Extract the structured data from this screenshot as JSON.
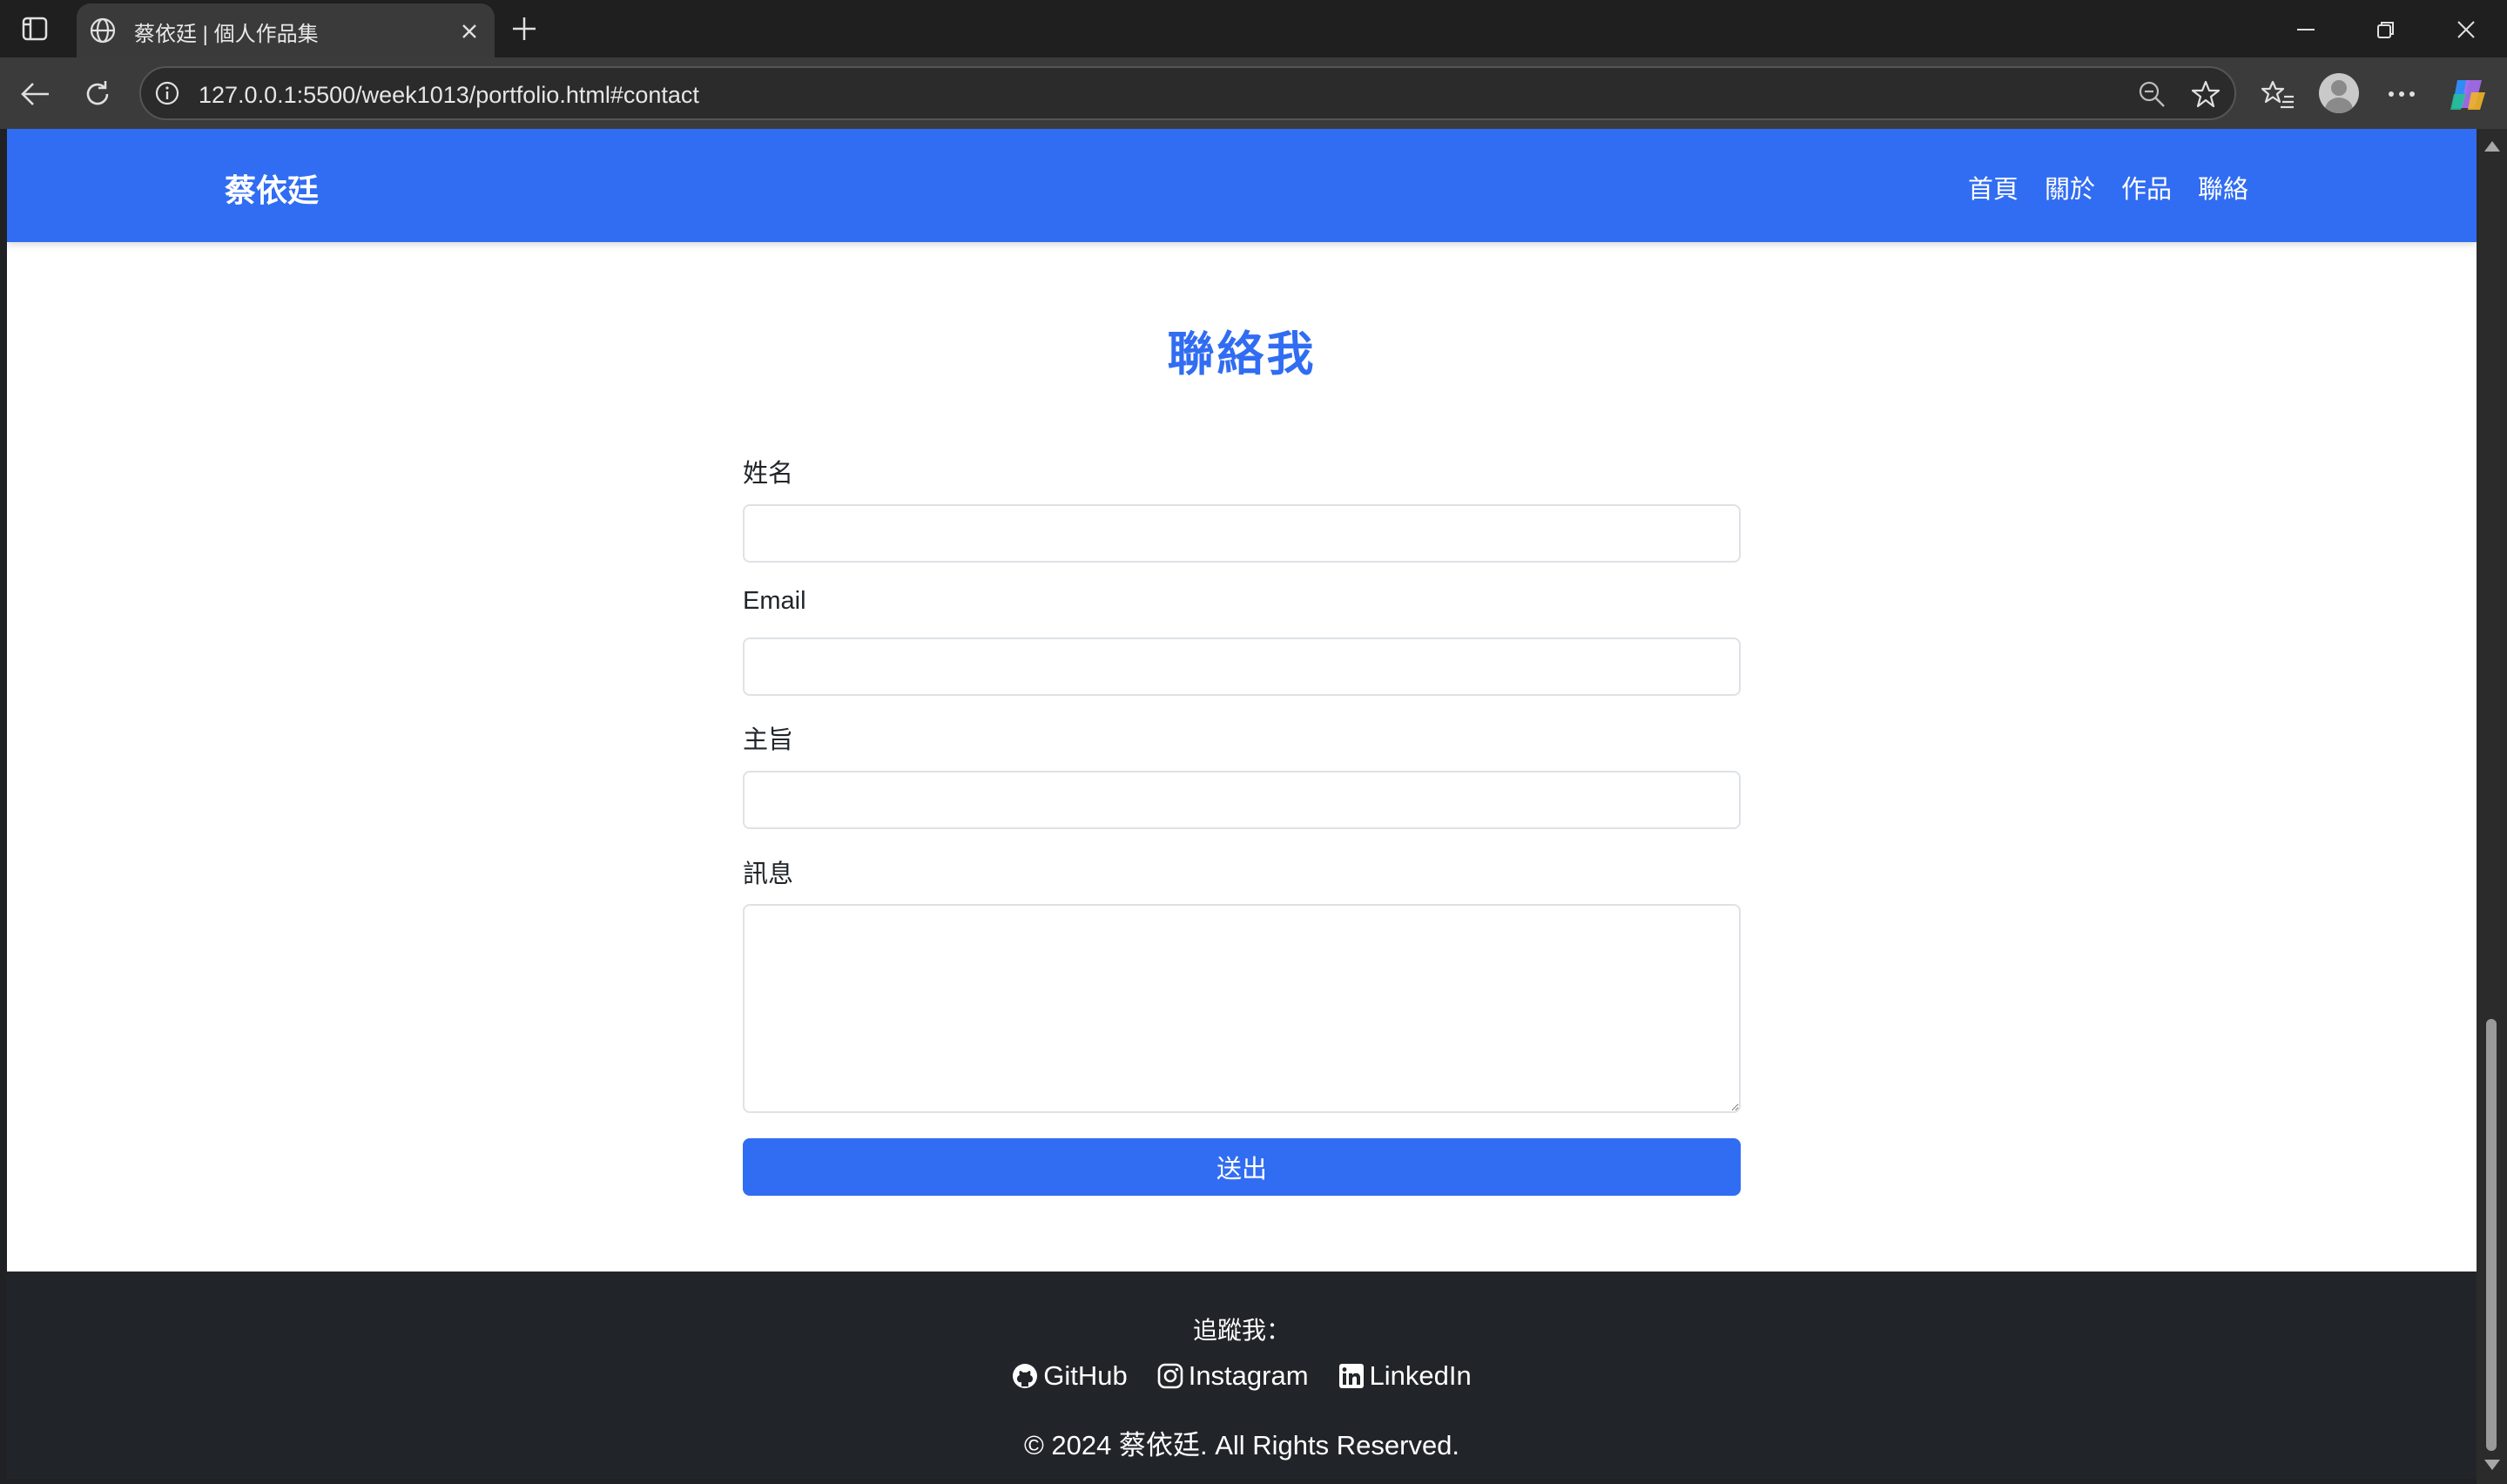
{
  "browser": {
    "tab_title": "蔡依廷 | 個人作品集",
    "url": "127.0.0.1:5500/week1013/portfolio.html#contact"
  },
  "site": {
    "brand": "蔡依廷",
    "nav": [
      {
        "label": "首頁"
      },
      {
        "label": "關於"
      },
      {
        "label": "作品"
      },
      {
        "label": "聯絡"
      }
    ],
    "primary_color": "#316df2",
    "footer_color": "#212529"
  },
  "contact": {
    "heading": "聯絡我",
    "fields": {
      "name": {
        "label": "姓名",
        "value": ""
      },
      "email": {
        "label": "Email",
        "value": ""
      },
      "subject": {
        "label": "主旨",
        "value": ""
      },
      "message": {
        "label": "訊息",
        "value": ""
      }
    },
    "submit_label": "送出"
  },
  "footer": {
    "follow_label": "追蹤我：",
    "links": [
      {
        "label": "GitHub",
        "icon": "github-icon"
      },
      {
        "label": "Instagram",
        "icon": "instagram-icon"
      },
      {
        "label": "LinkedIn",
        "icon": "linkedin-icon"
      }
    ],
    "copyright": "© 2024 蔡依廷. All Rights Reserved."
  }
}
